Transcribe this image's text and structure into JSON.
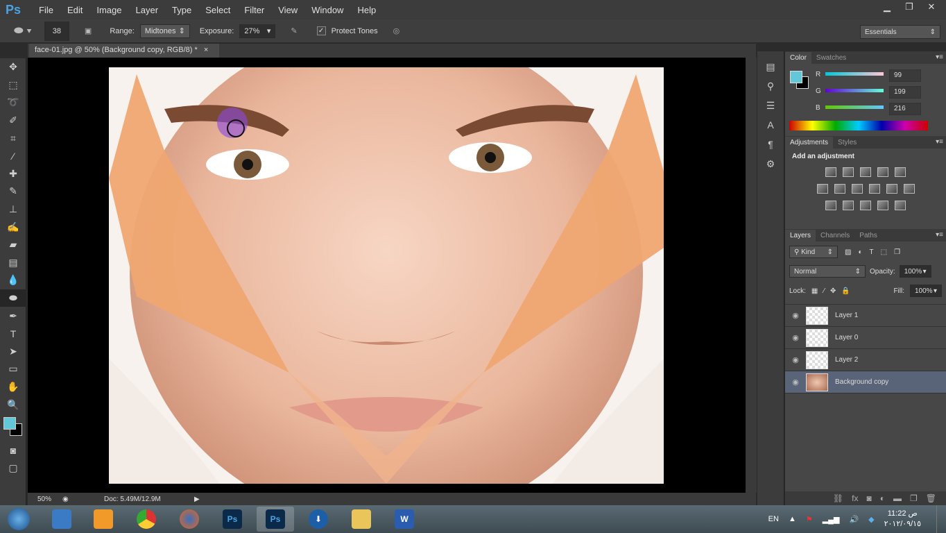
{
  "app": {
    "logo": "Ps",
    "menus": [
      "File",
      "Edit",
      "Image",
      "Layer",
      "Type",
      "Select",
      "Filter",
      "View",
      "Window",
      "Help"
    ],
    "window_buttons": [
      "minimize",
      "restore",
      "close"
    ]
  },
  "options": {
    "brush_size": "38",
    "range_label": "Range:",
    "range_value": "Midtones",
    "exposure_label": "Exposure:",
    "exposure_value": "27%",
    "protect_tones_label": "Protect Tones",
    "protect_tones_checked": true,
    "workspace": "Essentials"
  },
  "document": {
    "tab_title": "face-01.jpg @ 50% (Background copy, RGB/8) *",
    "close": "×"
  },
  "status": {
    "zoom": "50%",
    "doc": "Doc: 5.49M/12.9M"
  },
  "tools": [
    "move",
    "marquee",
    "lasso",
    "quick-select",
    "crop",
    "eyedropper",
    "healing",
    "brush",
    "clone-stamp",
    "history-brush",
    "eraser",
    "gradient",
    "blur",
    "sponge",
    "pen",
    "type",
    "path-select",
    "rectangle",
    "hand",
    "zoom"
  ],
  "color_panel": {
    "tabs": [
      "Color",
      "Swatches"
    ],
    "foreground": "#63c7d8",
    "background": "#000000",
    "r_label": "R",
    "g_label": "G",
    "b_label": "B",
    "r": "99",
    "g": "199",
    "b": "216"
  },
  "adjustments_panel": {
    "tabs": [
      "Adjustments",
      "Styles"
    ],
    "heading": "Add an adjustment"
  },
  "layers_panel": {
    "tabs": [
      "Layers",
      "Channels",
      "Paths"
    ],
    "filter": "Kind",
    "blend_mode": "Normal",
    "opacity_label": "Opacity:",
    "opacity": "100%",
    "lock_label": "Lock:",
    "fill_label": "Fill:",
    "fill": "100%",
    "layers": [
      {
        "name": "Layer 1",
        "visible": true,
        "selected": false
      },
      {
        "name": "Layer 0",
        "visible": true,
        "selected": false
      },
      {
        "name": "Layer 2",
        "visible": true,
        "selected": false
      },
      {
        "name": "Background copy",
        "visible": true,
        "selected": true
      }
    ]
  },
  "taskbar": {
    "apps": [
      "windows-media-center",
      "media-player",
      "chrome",
      "firefox",
      "photoshop",
      "photoshop-active",
      "download-manager",
      "explorer",
      "word"
    ],
    "lang": "EN",
    "time": "11:22 ص",
    "date": "٢٠١٢/٠٩/١٥"
  }
}
